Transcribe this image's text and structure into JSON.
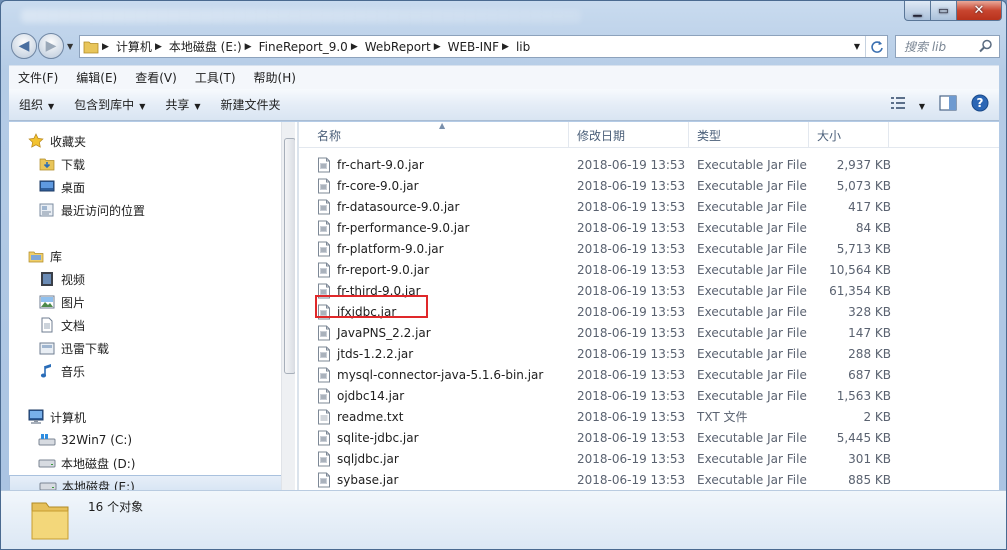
{
  "window": {
    "close_glyph": "✕",
    "max_glyph": "▭",
    "min_glyph": "▁"
  },
  "address": {
    "crumbs": [
      "计算机",
      "本地磁盘 (E:)",
      "FineReport_9.0",
      "WebReport",
      "WEB-INF",
      "lib"
    ],
    "search_placeholder": "搜索 lib"
  },
  "menubar": {
    "items": [
      "文件(F)",
      "编辑(E)",
      "查看(V)",
      "工具(T)",
      "帮助(H)"
    ]
  },
  "commandbar": {
    "organize": "组织",
    "include_in_library": "包含到库中",
    "share": "共享",
    "new_folder": "新建文件夹"
  },
  "nav": {
    "favorites": "收藏夹",
    "downloads": "下载",
    "desktop": "桌面",
    "recent": "最近访问的位置",
    "libraries": "库",
    "videos": "视频",
    "pictures": "图片",
    "documents": "文档",
    "thunder": "迅雷下载",
    "music": "音乐",
    "computer": "计算机",
    "drive_c": "32Win7  (C:)",
    "drive_d": "本地磁盘 (D:)",
    "drive_e": "本地磁盘 (E:)"
  },
  "columns": {
    "name": "名称",
    "date": "修改日期",
    "type": "类型",
    "size": "大小"
  },
  "files": [
    {
      "name": "fr-chart-9.0.jar",
      "date": "2018-06-19 13:53",
      "type": "Executable Jar File",
      "size": "2,937 KB",
      "icon": "jar-file-icon"
    },
    {
      "name": "fr-core-9.0.jar",
      "date": "2018-06-19 13:53",
      "type": "Executable Jar File",
      "size": "5,073 KB",
      "icon": "jar-file-icon"
    },
    {
      "name": "fr-datasource-9.0.jar",
      "date": "2018-06-19 13:53",
      "type": "Executable Jar File",
      "size": "417 KB",
      "icon": "jar-file-icon"
    },
    {
      "name": "fr-performance-9.0.jar",
      "date": "2018-06-19 13:53",
      "type": "Executable Jar File",
      "size": "84 KB",
      "icon": "jar-file-icon"
    },
    {
      "name": "fr-platform-9.0.jar",
      "date": "2018-06-19 13:53",
      "type": "Executable Jar File",
      "size": "5,713 KB",
      "icon": "jar-file-icon"
    },
    {
      "name": "fr-report-9.0.jar",
      "date": "2018-06-19 13:53",
      "type": "Executable Jar File",
      "size": "10,564 KB",
      "icon": "jar-file-icon"
    },
    {
      "name": "fr-third-9.0.jar",
      "date": "2018-06-19 13:53",
      "type": "Executable Jar File",
      "size": "61,354 KB",
      "icon": "jar-file-icon"
    },
    {
      "name": "ifxjdbc.jar",
      "date": "2018-06-19 13:53",
      "type": "Executable Jar File",
      "size": "328 KB",
      "icon": "jar-file-icon"
    },
    {
      "name": "JavaPNS_2.2.jar",
      "date": "2018-06-19 13:53",
      "type": "Executable Jar File",
      "size": "147 KB",
      "icon": "jar-file-icon"
    },
    {
      "name": "jtds-1.2.2.jar",
      "date": "2018-06-19 13:53",
      "type": "Executable Jar File",
      "size": "288 KB",
      "icon": "jar-file-icon"
    },
    {
      "name": "mysql-connector-java-5.1.6-bin.jar",
      "date": "2018-06-19 13:53",
      "type": "Executable Jar File",
      "size": "687 KB",
      "icon": "jar-file-icon"
    },
    {
      "name": "ojdbc14.jar",
      "date": "2018-06-19 13:53",
      "type": "Executable Jar File",
      "size": "1,563 KB",
      "icon": "jar-file-icon"
    },
    {
      "name": "readme.txt",
      "date": "2018-06-19 13:53",
      "type": "TXT 文件",
      "size": "2 KB",
      "icon": "text-file-icon"
    },
    {
      "name": "sqlite-jdbc.jar",
      "date": "2018-06-19 13:53",
      "type": "Executable Jar File",
      "size": "5,445 KB",
      "icon": "jar-file-icon"
    },
    {
      "name": "sqljdbc.jar",
      "date": "2018-06-19 13:53",
      "type": "Executable Jar File",
      "size": "301 KB",
      "icon": "jar-file-icon"
    },
    {
      "name": "sybase.jar",
      "date": "2018-06-19 13:53",
      "type": "Executable Jar File",
      "size": "885 KB",
      "icon": "jar-file-icon"
    }
  ],
  "status": {
    "count": "16 个对象"
  },
  "colors": {
    "highlight": "#e0282a",
    "accent": "#3a6fb0"
  }
}
